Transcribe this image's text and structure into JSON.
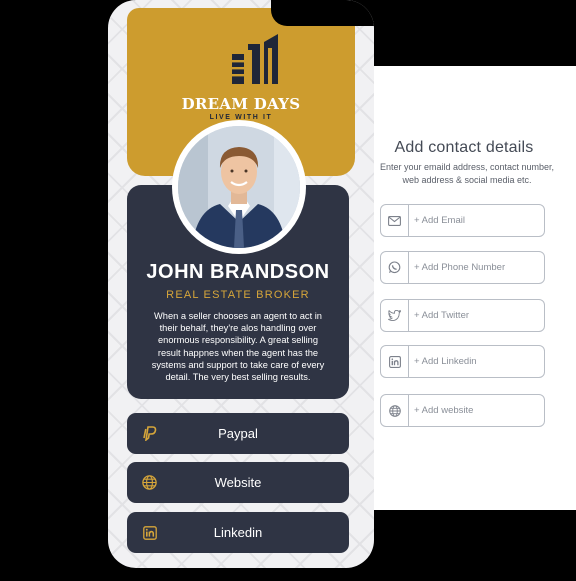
{
  "colors": {
    "accent_gold": "#cd9c2e",
    "card_navy": "#2f3444",
    "background": "#000000"
  },
  "header": {
    "logo_icon": "building-logo-icon",
    "brand_name": "DREAM DAYS",
    "tagline": "LIVE WITH IT"
  },
  "profile": {
    "avatar": "profile-photo",
    "name": "JOHN BRANDSON",
    "title": "REAL ESTATE BROKER",
    "bio": "When a seller chooses an agent to act in their behalf, they're alos handling over enormous responsibility. A great selling result happnes when the agent has the systems and support to take care of every detail. The very best selling results."
  },
  "links": [
    {
      "label": "Paypal",
      "icon": "paypal-icon"
    },
    {
      "label": "Website",
      "icon": "globe-icon"
    },
    {
      "label": "Linkedin",
      "icon": "linkedin-icon"
    }
  ],
  "contact_panel": {
    "title": "Add contact details",
    "subtitle": "Enter your emaild address, contact number, web address & social media etc.",
    "fields": [
      {
        "label": "+ Add Email",
        "icon": "envelope-icon"
      },
      {
        "label": "+ Add Phone Number",
        "icon": "whatsapp-icon"
      },
      {
        "label": "+ Add Twitter",
        "icon": "twitter-icon"
      },
      {
        "label": "+ Add Linkedin",
        "icon": "linkedin-icon"
      },
      {
        "label": "+ Add website",
        "icon": "globe-icon"
      }
    ]
  }
}
